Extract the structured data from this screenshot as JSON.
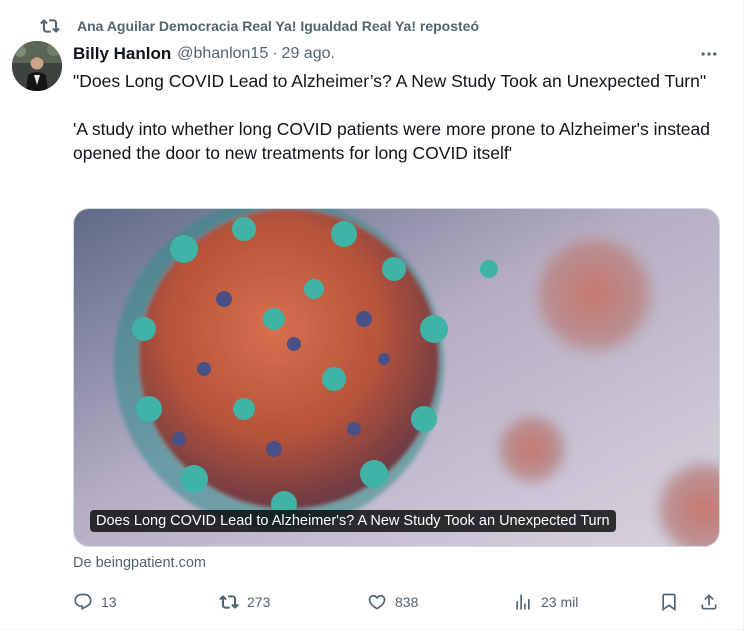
{
  "repost": {
    "text": "Ana Aguilar Democracia Real Ya! Igualdad Real Ya! reposteó",
    "icon": "repost-icon"
  },
  "author": {
    "name": "Billy Hanlon",
    "handle": "@bhanlon15",
    "separator": "·",
    "time": "29 ago."
  },
  "tweet": {
    "text": "\"Does Long COVID Lead to Alzheimer’s? A New Study Took an Unexpected Turn\"\n\n'A study into whether long COVID patients were more prone to Alzheimer's instead opened the door to new treatments for long COVID itself'"
  },
  "card": {
    "caption": "Does Long COVID Lead to Alzheimer's? A New Study Took an Unexpected Turn",
    "source": "De beingpatient.com"
  },
  "actions": {
    "replies": "13",
    "reposts": "273",
    "likes": "838",
    "views": "23 mil"
  },
  "colors": {
    "text": "#0f1419",
    "secondary": "#536471",
    "border": "#cfd9de"
  }
}
